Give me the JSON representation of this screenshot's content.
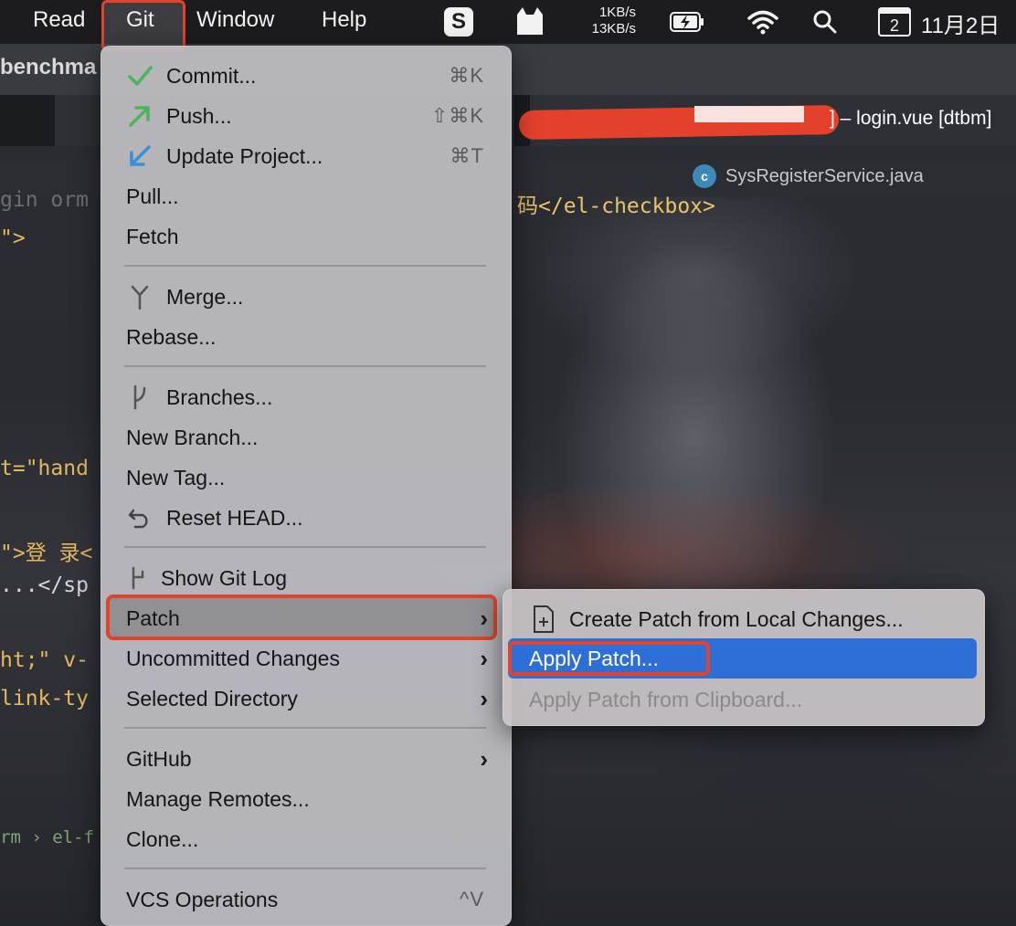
{
  "menubar": {
    "items": [
      "Read",
      "Git",
      "Window",
      "Help"
    ],
    "active": "Git",
    "status": {
      "app_logo": "S",
      "net_up": "1KB/s",
      "net_down": "13KB/s",
      "calendar_day": "2",
      "date": "11月2日"
    }
  },
  "ide": {
    "project_name": "benchma",
    "window_title": "] – login.vue [dtbm]",
    "open_file_tab": "SysRegisterService.java",
    "file_tab_icon_letter": "c",
    "code_lines": [
      "gin orm",
      "\">",
      "t=\"hand",
      "\">登 录<",
      "...</sp",
      "ht;\" v-",
      "link-ty"
    ],
    "code_top_right": "码</el-checkbox>",
    "breadcrumb": "rm  ›  el-f"
  },
  "git_menu": {
    "items": [
      {
        "label": "Commit...",
        "shortcut": "⌘K",
        "icon": "check-icon"
      },
      {
        "label": "Push...",
        "shortcut": "⇧⌘K",
        "icon": "push-arrow-icon"
      },
      {
        "label": "Update Project...",
        "shortcut": "⌘T",
        "icon": "update-arrow-icon"
      },
      {
        "label": "Pull..."
      },
      {
        "label": "Fetch"
      },
      {
        "label": "Merge...",
        "icon": "merge-icon"
      },
      {
        "label": "Rebase..."
      },
      {
        "label": "Branches...",
        "icon": "branch-icon"
      },
      {
        "label": "New Branch..."
      },
      {
        "label": "New Tag..."
      },
      {
        "label": "Reset HEAD...",
        "icon": "reset-icon"
      },
      {
        "label": "Show Git Log",
        "icon": "git-log-icon"
      },
      {
        "label": "Patch",
        "submenu": true
      },
      {
        "label": "Uncommitted Changes",
        "submenu": true
      },
      {
        "label": "Selected Directory",
        "submenu": true
      },
      {
        "label": "GitHub",
        "submenu": true
      },
      {
        "label": "Manage Remotes..."
      },
      {
        "label": "Clone..."
      },
      {
        "label": "VCS Operations",
        "shortcut": "^V"
      }
    ]
  },
  "patch_submenu": {
    "items": [
      {
        "label": "Create Patch from Local Changes...",
        "icon": "patch-file-icon"
      },
      {
        "label": "Apply Patch...",
        "selected": true
      },
      {
        "label": "Apply Patch from Clipboard...",
        "disabled": true
      }
    ]
  },
  "colors": {
    "highlight_box": "#e0442d",
    "selected_item": "#2d6fd6",
    "menu_bg": "#bebec4"
  }
}
